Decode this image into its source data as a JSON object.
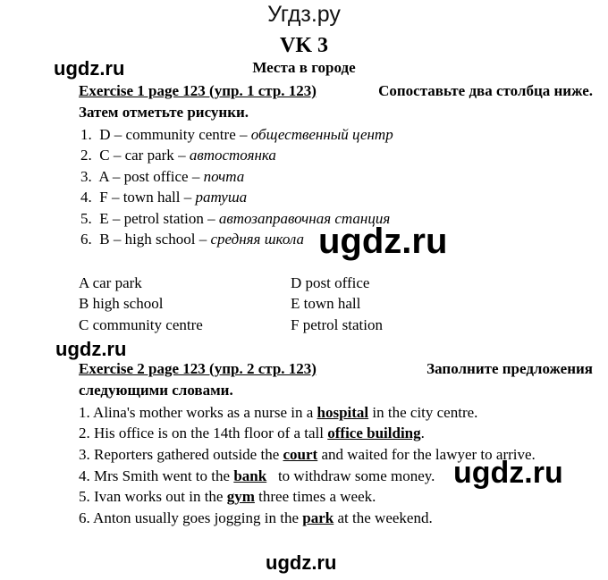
{
  "site_title": "Угдз.ру",
  "heading": "VK 3",
  "subtitle": "Места в городе",
  "watermark": "ugdz.ru",
  "exercise1": {
    "ref": "Exercise 1 page 123 (упр. 1 стр. 123)",
    "instruction_line1": "Сопоставьте два столбца ниже.",
    "instruction_line2": "Затем отметьте рисунки.",
    "answers": [
      {
        "num": "1.",
        "en": "D – community centre",
        "ru": "общественный центр"
      },
      {
        "num": "2.",
        "en": "C – car park",
        "ru": "автостоянка"
      },
      {
        "num": "3.",
        "en": "A – post office",
        "ru": "почта"
      },
      {
        "num": "4.",
        "en": "F – town hall",
        "ru": "ратуша"
      },
      {
        "num": "5.",
        "en": "E – petrol station",
        "ru": "автозаправочная станция"
      },
      {
        "num": "6.",
        "en": "B – high school",
        "ru": "средняя школа"
      }
    ],
    "pictures_left": [
      "A car park",
      "B high school",
      "C community centre"
    ],
    "pictures_right": [
      "D post office",
      "E town hall",
      "F petrol station"
    ]
  },
  "exercise2": {
    "ref": "Exercise 2 page 123 (упр. 2 стр. 123)",
    "instruction_line1": "Заполните предложения",
    "instruction_line2": "следующими словами.",
    "sentences": [
      {
        "before": "1. Alina's mother works as a nurse in a ",
        "answer": "hospital",
        "after": " in the city centre."
      },
      {
        "before": "2. His office is on the 14th floor of a tall ",
        "answer": "office building",
        "after": "."
      },
      {
        "before": "3. Reporters gathered outside the ",
        "answer": "court",
        "after": " and waited for the lawyer to arrive."
      },
      {
        "before": "4. Mrs Smith went to the ",
        "answer": "bank",
        "after": "   to withdraw some money."
      },
      {
        "before": "5. Ivan works out in the ",
        "answer": "gym",
        "after": " three times a week."
      },
      {
        "before": "6. Anton usually goes jogging in the ",
        "answer": "park",
        "after": " at the weekend."
      }
    ]
  }
}
